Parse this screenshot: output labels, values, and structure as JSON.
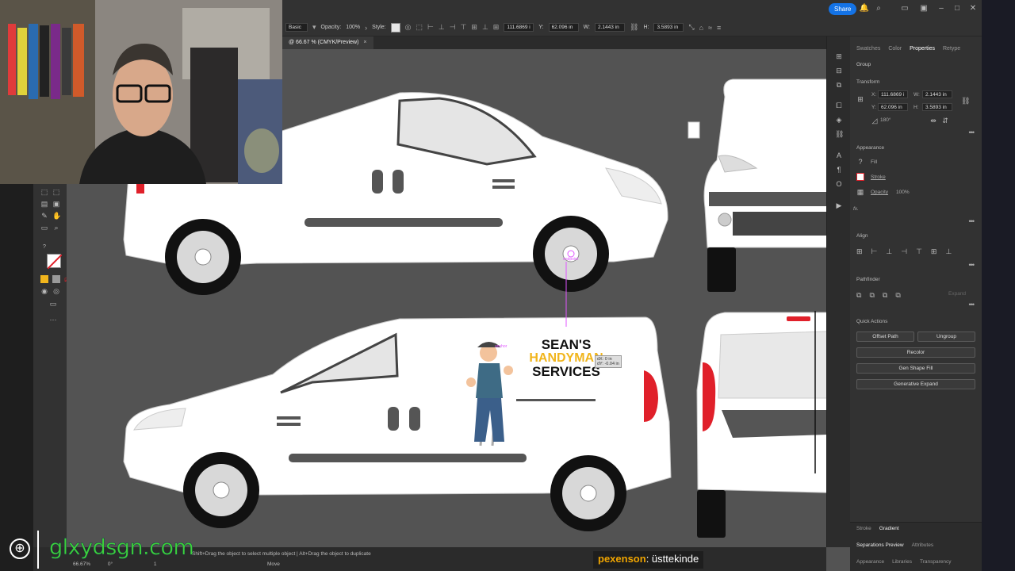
{
  "toolbar": {
    "style_basic": "Basic",
    "opacity_label": "Opacity:",
    "opacity_value": "100%",
    "style_label": "Style:",
    "x_value": "111.6869 i",
    "y_label": "Y:",
    "y_value": "62.096 in",
    "w_label": "W:",
    "w_value": "2.1443 in",
    "h_label": "H:",
    "h_value": "3.5893 in"
  },
  "topbar": {
    "share_label": "Share"
  },
  "document_tab": {
    "title": "@ 66.67 % (CMYK/Preview)",
    "close": "×"
  },
  "properties": {
    "tabs": [
      "Swatches",
      "Color",
      "Properties",
      "Retype"
    ],
    "active_tab": "Properties",
    "selection_type": "Group",
    "transform": {
      "heading": "Transform",
      "x_label": "X:",
      "x": "111.6869 i",
      "y_label": "Y:",
      "y": "62.096 in",
      "w_label": "W:",
      "w": "2.1443 in",
      "h_label": "H:",
      "h": "3.5893 in",
      "rotate": "180°"
    },
    "appearance": {
      "heading": "Appearance",
      "fill_label": "Fill",
      "stroke_label": "Stroke",
      "opacity_label": "Opacity",
      "opacity_value": "100%",
      "fx": "fx."
    },
    "align_heading": "Align",
    "pathfinder": {
      "heading": "Pathfinder",
      "expand": "Expand"
    },
    "quick_actions": {
      "heading": "Quick Actions",
      "offset_path": "Offset Path",
      "ungroup": "Ungroup",
      "recolor": "Recolor",
      "gen_shape_fill": "Gen Shape Fill",
      "generative_expand": "Generative Expand"
    },
    "bottom_tabs_row1": [
      "Stroke",
      "Gradient"
    ],
    "bottom_tabs_row2": [
      "Separations Preview",
      "Attributes"
    ],
    "bottom_tabs_row3": [
      "Appearance",
      "Libraries",
      "Transparency"
    ]
  },
  "canvas": {
    "logo_line1": "SEAN'S",
    "logo_line2": "HANDYMAN",
    "logo_line3": "SERVICES",
    "smart_guide_dx": "dX: 0 in",
    "smart_guide_dy": "dY: -0.04 in",
    "anchor_label": "anchor",
    "endpoint_label": "endpoint"
  },
  "statusbar": {
    "zoom": "66.67%",
    "angle": "0°",
    "artboard": "1",
    "message": "Shift+Drag the object to select multiple object  |  Alt+Drag the object to duplicate",
    "mode": "Move"
  },
  "overlay": {
    "watermark": "glxydsgn.com",
    "chat_user": "pexenson",
    "chat_message": ": üsttekinde"
  },
  "colors": {
    "accent_blue": "#1473e6",
    "logo_gold": "#f1b51c",
    "watermark_green": "#3dd13a",
    "taillight_red": "#e0202a"
  }
}
